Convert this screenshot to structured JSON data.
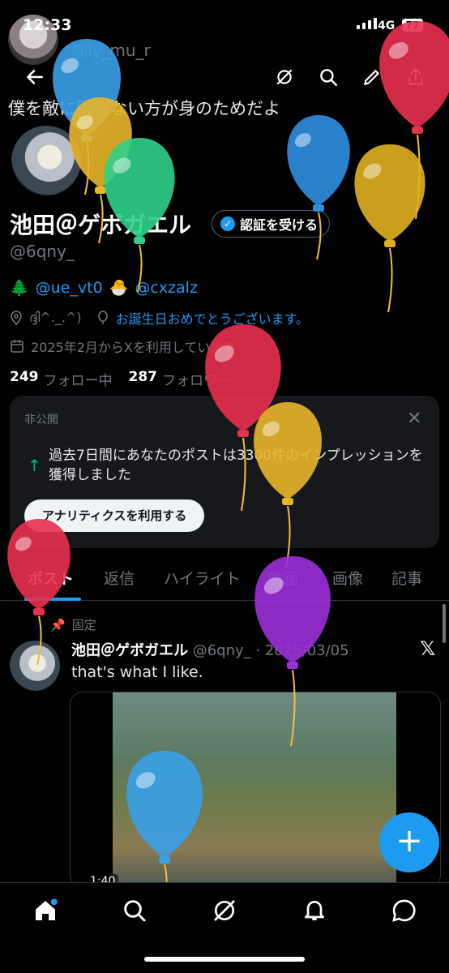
{
  "status": {
    "time": "12:33",
    "network": "4G",
    "battery": "77"
  },
  "header": {
    "top_handle": "@ly_mu_r"
  },
  "profile": {
    "bio": "僕を敵に回さない方が身のためだよ",
    "display_name": "池田＠ゲボガエル",
    "verify_label": "認証を受ける",
    "username": "@6qny_",
    "link_emoji_1": "🌲",
    "link_1": "@ue_vt0",
    "link_emoji_2": "🐣",
    "link_2": "@cxzalz",
    "location": "ദ്ദി^._.^)",
    "birthday": "お誕生日おめでとうございます。",
    "joined": "2025年2月からXを利用しています",
    "following_count": "249",
    "following_label": "フォロー中",
    "followers_count": "287",
    "followers_label": "フォロワー"
  },
  "private_card": {
    "title": "非公開",
    "text": "過去7日間にあなたのポストは3300件のインプレッションを獲得しました",
    "button": "アナリティクスを利用する"
  },
  "tabs": [
    "ポスト",
    "返信",
    "ハイライト",
    "動画",
    "画像",
    "記事"
  ],
  "pinned_post": {
    "pinned_label": "固定",
    "author": "池田＠ゲボガエル",
    "handle_date": "@6qny_ · 2025/03/05",
    "text": "that's what I like.",
    "video_time": "1:40"
  },
  "fab_label": "+",
  "colors": {
    "accent": "#1d9bf0",
    "background": "#000000",
    "card": "#16181c",
    "muted": "#71767b"
  },
  "balloons": [
    {
      "color": "#3aa0e8"
    },
    {
      "color": "#e8b52a"
    },
    {
      "color": "#2fd08a"
    },
    {
      "color": "#2f8fe0"
    },
    {
      "color": "#e8304f"
    },
    {
      "color": "#e0b020"
    },
    {
      "color": "#e8304f"
    },
    {
      "color": "#e8b52a"
    },
    {
      "color": "#e8304f"
    },
    {
      "color": "#9b30d8"
    },
    {
      "color": "#3aa0e8"
    }
  ]
}
